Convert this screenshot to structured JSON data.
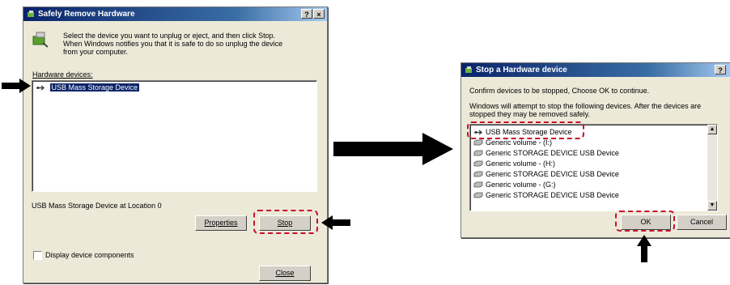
{
  "dialog1": {
    "title": "Safely Remove Hardware",
    "help_glyph": "?",
    "close_glyph": "×",
    "instruction": "Select the device you want to unplug or eject, and then click Stop. When Windows notifies you that it is safe to do so unplug the device from your computer.",
    "devices_label": "Hardware devices:",
    "selected_device": "USB Mass Storage Device",
    "location_text": "USB Mass Storage Device at Location 0",
    "properties_label": "Properties",
    "stop_label": "Stop",
    "display_components_label": "Display device components",
    "close_label": "Close"
  },
  "dialog2": {
    "title": "Stop a Hardware device",
    "help_glyph": "?",
    "confirm_text": "Confirm devices to be stopped, Choose OK to continue.",
    "info_text": "Windows will attempt to stop the following devices. After the devices are stopped they may be removed safely.",
    "devices": [
      "USB Mass Storage Device",
      "Generic volume - (I:)",
      "Generic STORAGE DEVICE USB Device",
      "Generic volume - (H:)",
      "Generic STORAGE DEVICE USB Device",
      "Generic volume - (G:)",
      "Generic STORAGE DEVICE USB Device"
    ],
    "ok_label": "OK",
    "cancel_label": "Cancel"
  },
  "colors": {
    "highlight_dash": "#c8102e",
    "selection": "#0a246a",
    "title_gradient_start": "#0a246a"
  },
  "icons": [
    "usb-device-icon",
    "drive-icon",
    "hardware-icon",
    "arrow-icon"
  ]
}
